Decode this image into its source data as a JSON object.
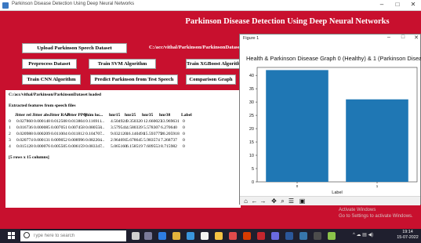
{
  "window": {
    "title": "Parkinson Disease Detection Using Deep Neural Networks",
    "minimize": "–",
    "maximize": "□",
    "close": "✕"
  },
  "banner": "Parkinson Disease Detection Using Deep Neural Networks",
  "buttons": {
    "upload": "Upload Parkinson Speech Dataset",
    "preprocess": "Preprocess Dataset",
    "train_svm": "Train SVM Algorithm",
    "train_xgboost": "Train XGBoost Algorithm",
    "train_cnn": "Train CNN Algorithm",
    "predict": "Predict Parkinson from Test Speech",
    "comparison": "Comparison Graph"
  },
  "dataset_path": "C:/acc/vithal/Parkinson/ParkinsonDataset",
  "output": {
    "loaded_line": "C:/acc/vithal/Parkinson/ParkinsonDataset loaded",
    "extracted_line": "Extracted features from speech files",
    "columns": [
      "Jitter rel",
      "Jitter abs",
      "Jitter RAP",
      "Jitter PPQ",
      "Shim loc",
      "...",
      "hnr15",
      "hnr25",
      "hnr35",
      "hnr38",
      "Label"
    ],
    "rows": [
      [
        "0",
        "0.027860",
        "0.000148",
        "0.012508",
        "0.013804",
        "0.116911",
        "...",
        "4.504924",
        "9.350320",
        "12.660023",
        "13.969631",
        "0"
      ],
      [
        "1",
        "0.016736",
        "0.000085",
        "0.007051",
        "0.007458",
        "0.080558",
        "...",
        "3.579541",
        "4.580339",
        "5.578307",
        "6.270640",
        "0"
      ],
      [
        "2",
        "0.020988",
        "0.000209",
        "0.011004",
        "0.011812",
        "0.104707",
        "...",
        "9.032120",
        "16.140491",
        "15.593779",
        "20.205918",
        "0"
      ],
      [
        "3",
        "0.020774",
        "0.000131",
        "0.009052",
        "0.008996",
        "0.082204",
        "...",
        "2.964691",
        "5.678645",
        "5.983574",
        "7.268737",
        "0"
      ],
      [
        "4",
        "0.015128",
        "0.000076",
        "0.005505",
        "0.006159",
        "0.083347",
        "...",
        "5.065160",
        "6.158519",
        "7.609553",
        "8.715982",
        "0"
      ]
    ],
    "summary": "[5 rows x 15 columns]"
  },
  "figure": {
    "window_title": "Figure 1",
    "tools": [
      "home-icon",
      "back-icon",
      "forward-icon",
      "pan-icon",
      "zoom-icon",
      "configure-icon",
      "save-icon"
    ]
  },
  "chart_data": {
    "type": "bar",
    "title": "Health & Parkinson Disease Graph 0 (Healthy) & 1 (Parkinson Disease)",
    "xlabel": "Label",
    "ylabel": "",
    "categories": [
      "0",
      "1"
    ],
    "values": [
      42,
      31
    ],
    "ylim": [
      0,
      43
    ],
    "yticks": [
      0,
      5,
      10,
      15,
      20,
      25,
      30,
      35,
      40
    ],
    "color": "#1f77b4"
  },
  "taskbar": {
    "search_placeholder": "Type here to search",
    "time": "19:14",
    "date": "15-07-2022"
  },
  "watermark": {
    "line1": "Activate Windows",
    "line2": "Go to Settings to activate Windows."
  }
}
